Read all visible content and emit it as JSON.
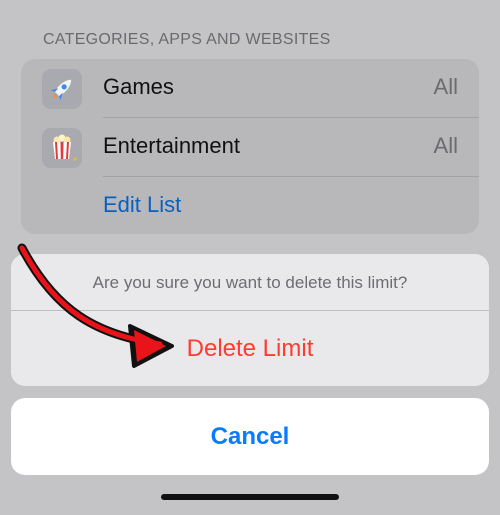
{
  "section_header": "CATEGORIES, APPS AND WEBSITES",
  "list": {
    "items": [
      {
        "icon": "rocket-icon",
        "label": "Games",
        "value": "All"
      },
      {
        "icon": "popcorn-icon",
        "label": "Entertainment",
        "value": "All"
      }
    ],
    "edit_label": "Edit List"
  },
  "action_sheet": {
    "message": "Are you sure you want to delete this limit?",
    "delete_label": "Delete Limit",
    "cancel_label": "Cancel"
  },
  "colors": {
    "destructive": "#ff3b30",
    "accent": "#0a7aff",
    "annotation_arrow": "#e8141a"
  }
}
